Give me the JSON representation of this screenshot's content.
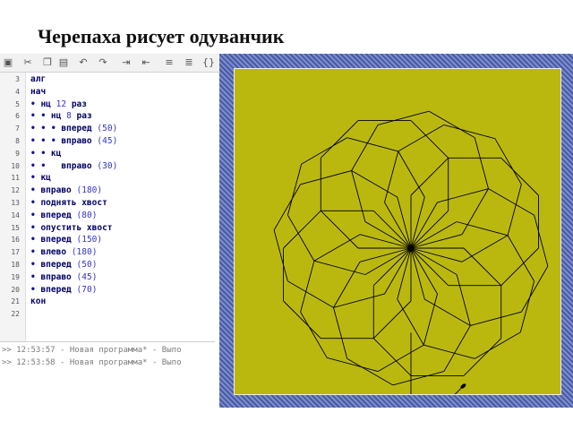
{
  "slide": {
    "title": "Черепаха рисует одуванчик"
  },
  "toolbar": {
    "icons": [
      "save-icon",
      "cut-icon",
      "copy-icon",
      "paste-icon",
      "undo-icon",
      "redo-icon",
      "indent-icon",
      "unindent-icon",
      "comment-icon",
      "uncomment-icon",
      "braces-icon"
    ]
  },
  "editor": {
    "lines": [
      {
        "num": "3",
        "prefix": "",
        "kw": "алг",
        "arg": ""
      },
      {
        "num": "4",
        "prefix": "",
        "kw": "нач",
        "arg": ""
      },
      {
        "num": "5",
        "prefix": "• ",
        "kw": "нц",
        "arg": "12",
        "suffix": " раз"
      },
      {
        "num": "6",
        "prefix": "• • ",
        "kw": "нц",
        "arg": "8",
        "suffix": " раз"
      },
      {
        "num": "7",
        "prefix": "• • • ",
        "kw": "вперед",
        "arg": "50"
      },
      {
        "num": "8",
        "prefix": "• • • ",
        "kw": "вправо",
        "arg": "45"
      },
      {
        "num": "9",
        "prefix": "• • ",
        "kw": "кц",
        "arg": ""
      },
      {
        "num": "10",
        "prefix": "• •   ",
        "kw": "вправо",
        "arg": "30"
      },
      {
        "num": "11",
        "prefix": "• ",
        "kw": "кц",
        "arg": ""
      },
      {
        "num": "12",
        "prefix": "• ",
        "kw": "вправо",
        "arg": "180"
      },
      {
        "num": "13",
        "prefix": "• ",
        "kw": "поднять хвост",
        "arg": ""
      },
      {
        "num": "14",
        "prefix": "• ",
        "kw": "вперед",
        "arg": "80"
      },
      {
        "num": "15",
        "prefix": "• ",
        "kw": "опустить хвост",
        "arg": ""
      },
      {
        "num": "16",
        "prefix": "• ",
        "kw": "вперед",
        "arg": "150"
      },
      {
        "num": "17",
        "prefix": "• ",
        "kw": "влево",
        "arg": "180"
      },
      {
        "num": "18",
        "prefix": "• ",
        "kw": "вперед",
        "arg": "50"
      },
      {
        "num": "19",
        "prefix": "• ",
        "kw": "вправо",
        "arg": "45"
      },
      {
        "num": "20",
        "prefix": "• ",
        "kw": "вперед",
        "arg": "70"
      },
      {
        "num": "21",
        "prefix": "",
        "kw": "кон",
        "arg": ""
      },
      {
        "num": "22",
        "prefix": "",
        "kw": "",
        "arg": ""
      }
    ]
  },
  "console": {
    "lines": [
      ">> 12:53:57 - Новая программа* - Выпо",
      ">> 12:53:58 - Новая программа* - Выпо"
    ]
  },
  "turtle_canvas": {
    "background_color": "#bab80f",
    "line_color": "#000000",
    "frame_color": "#5f6fb5"
  }
}
